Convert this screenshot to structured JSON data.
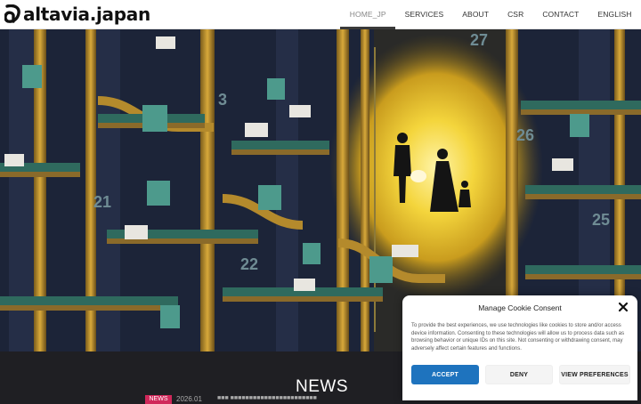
{
  "header": {
    "logo_text": "altavia.japan",
    "nav": [
      {
        "label": "HOME_JP",
        "active": true
      },
      {
        "label": "SERVICES",
        "active": false
      },
      {
        "label": "ABOUT",
        "active": false
      },
      {
        "label": "CSR",
        "active": false
      },
      {
        "label": "CONTACT",
        "active": false
      },
      {
        "label": "ENGLISH",
        "active": false
      }
    ]
  },
  "hero": {
    "numbers": [
      "27",
      "26",
      "21",
      "22",
      "25",
      "3"
    ]
  },
  "news": {
    "title": "NEWS",
    "tag": "NEWS",
    "date": "2026.01",
    "text": "■■■ ■■■■■■■■■■■■■■■■■■■■■■■"
  },
  "cookie": {
    "title": "Manage Cookie Consent",
    "body": "To provide the best experiences, we use technologies like cookies to store and/or access device information. Consenting to these technologies will allow us to process data such as browsing behavior or unique IDs on this site. Not consenting or withdrawing consent, may adversely affect certain features and functions.",
    "accept_label": "ACCEPT",
    "deny_label": "DENY",
    "preferences_label": "VIEW PREFERENCES"
  },
  "colors": {
    "accent_blue": "#1e73be",
    "news_tag": "#d0285a",
    "hero_glow": "#f2d33a"
  }
}
